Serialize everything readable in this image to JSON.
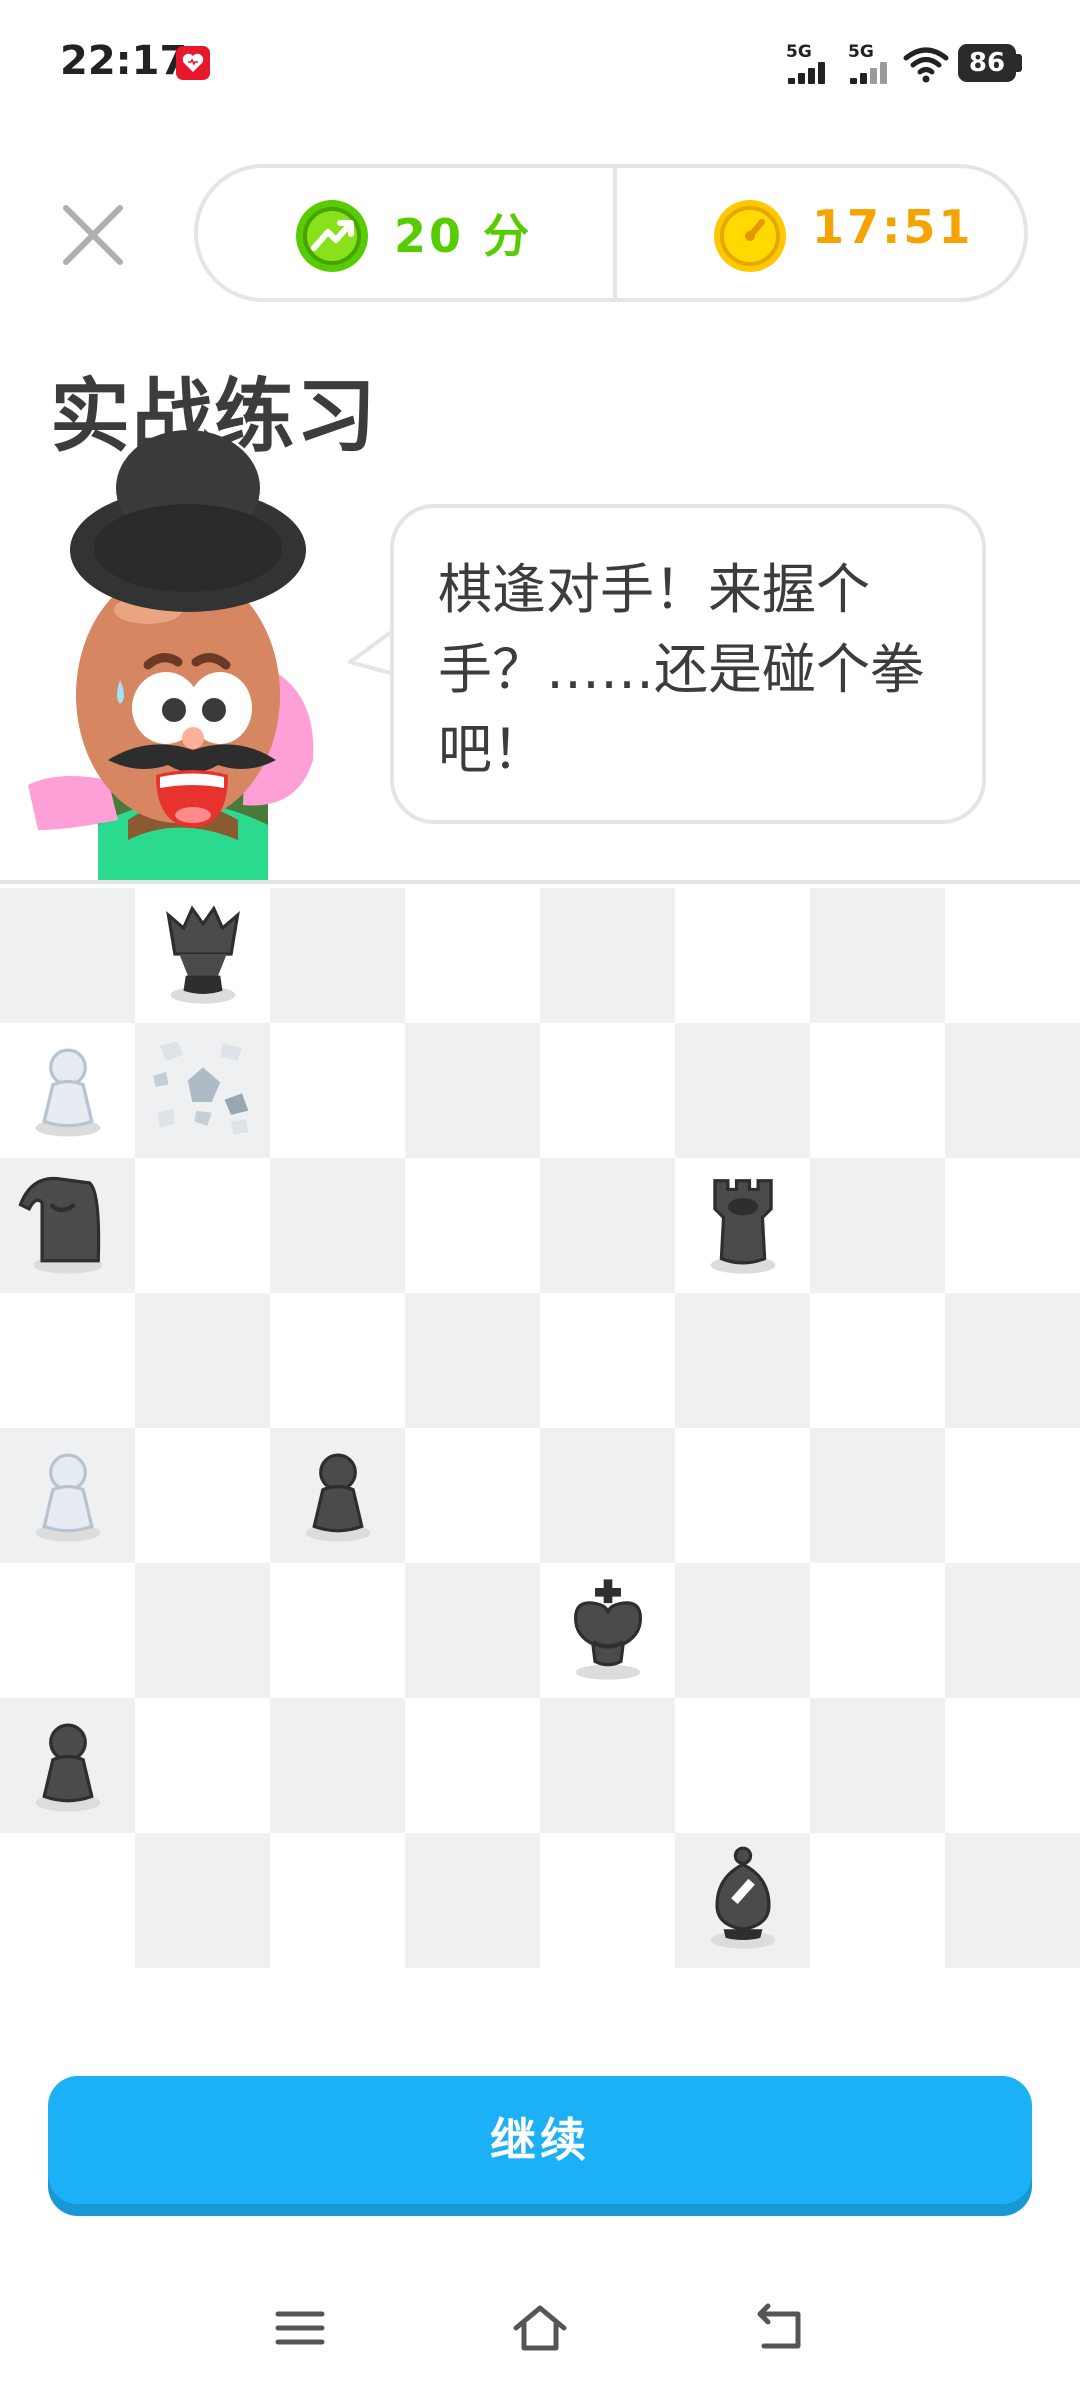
{
  "status_bar": {
    "time": "22:17",
    "notification_icon": "heart-app-icon",
    "signals": [
      {
        "label": "5G",
        "bars": 4
      },
      {
        "label": "5G",
        "bars": 4
      }
    ],
    "wifi_icon": "wifi-icon",
    "battery": "86"
  },
  "header": {
    "close_icon": "close-icon",
    "score_icon": "trend-up-icon",
    "score": "20 分",
    "timer_icon": "timer-icon",
    "time_left": "17:51"
  },
  "page_title": "实战练习",
  "character": {
    "icon": "mustache-coach-character"
  },
  "speech": "棋逢对手！来握个手？……还是碰个拳吧！",
  "board": {
    "light_color": "#ffffff",
    "dark_color": "#eef0f2",
    "pieces": [
      {
        "name": "black-queen-piece",
        "type": "queen",
        "color": "black",
        "row": 0,
        "col": 1
      },
      {
        "name": "white-pawn-piece",
        "type": "pawn",
        "color": "white",
        "row": 1,
        "col": 0
      },
      {
        "name": "shattered-white-piece",
        "type": "shattered",
        "color": "white",
        "row": 1,
        "col": 1
      },
      {
        "name": "black-knight-piece",
        "type": "knight",
        "color": "black",
        "row": 2,
        "col": 0
      },
      {
        "name": "black-rook-piece",
        "type": "rook",
        "color": "black",
        "row": 2,
        "col": 5
      },
      {
        "name": "white-pawn-piece",
        "type": "pawn",
        "color": "white",
        "row": 4,
        "col": 0
      },
      {
        "name": "black-pawn-piece",
        "type": "pawn",
        "color": "black",
        "row": 4,
        "col": 2
      },
      {
        "name": "black-king-piece",
        "type": "king",
        "color": "black",
        "row": 5,
        "col": 4
      },
      {
        "name": "black-pawn-piece",
        "type": "pawn",
        "color": "black",
        "row": 6,
        "col": 0
      },
      {
        "name": "black-bishop-piece",
        "type": "bishop",
        "color": "black",
        "row": 7,
        "col": 5
      }
    ]
  },
  "continue_label": "继续",
  "nav": {
    "menu_icon": "menu-icon",
    "home_icon": "home-icon",
    "back_icon": "back-icon"
  },
  "colors": {
    "accent_blue": "#1cb0f6",
    "score_green": "#58cc02",
    "timer_orange": "#f5a300"
  }
}
